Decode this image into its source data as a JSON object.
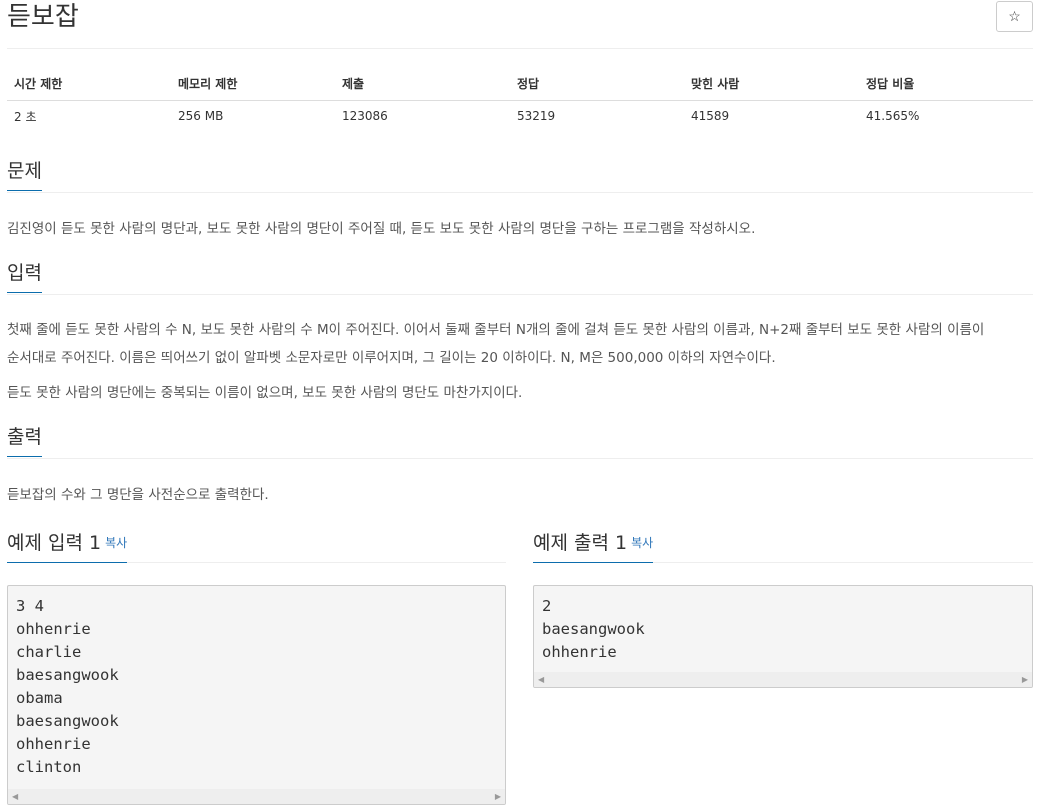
{
  "problem": {
    "title": "듣보잡",
    "star_icon": "☆"
  },
  "info_table": {
    "headers": [
      "시간 제한",
      "메모리 제한",
      "제출",
      "정답",
      "맞힌 사람",
      "정답 비율"
    ],
    "values": [
      "2 초",
      "256 MB",
      "123086",
      "53219",
      "41589",
      "41.565%"
    ]
  },
  "sections": {
    "problem": {
      "title": "문제",
      "text": "김진영이 듣도 못한 사람의 명단과, 보도 못한 사람의 명단이 주어질 때, 듣도 보도 못한 사람의 명단을 구하는 프로그램을 작성하시오."
    },
    "input": {
      "title": "입력",
      "line1": "첫째 줄에 듣도 못한 사람의 수 N, 보도 못한 사람의 수 M이 주어진다. 이어서 둘째 줄부터 N개의 줄에 걸쳐 듣도 못한 사람의 이름과, N+2째 줄부터 보도 못한 사람의 이름이",
      "line2": "순서대로 주어진다. 이름은 띄어쓰기 없이 알파벳 소문자로만 이루어지며, 그 길이는 20 이하이다. N, M은 500,000 이하의 자연수이다.",
      "line3": "듣도 못한 사람의 명단에는 중복되는 이름이 없으며, 보도 못한 사람의 명단도 마찬가지이다."
    },
    "output": {
      "title": "출력",
      "text": "듣보잡의 수와 그 명단을 사전순으로 출력한다."
    }
  },
  "examples": {
    "input": {
      "title": "예제 입력 1",
      "copy_label": "복사",
      "lines": [
        "3 4",
        "ohhenrie",
        "charlie",
        "baesangwook",
        "obama",
        "baesangwook",
        "ohhenrie",
        "clinton"
      ]
    },
    "output": {
      "title": "예제 출력 1",
      "copy_label": "복사",
      "lines": [
        "2",
        "baesangwook",
        "ohhenrie"
      ]
    }
  },
  "colors": {
    "accent": "#0c6dad",
    "link": "#2f76b9",
    "sample_bg": "#f5f5f5"
  }
}
